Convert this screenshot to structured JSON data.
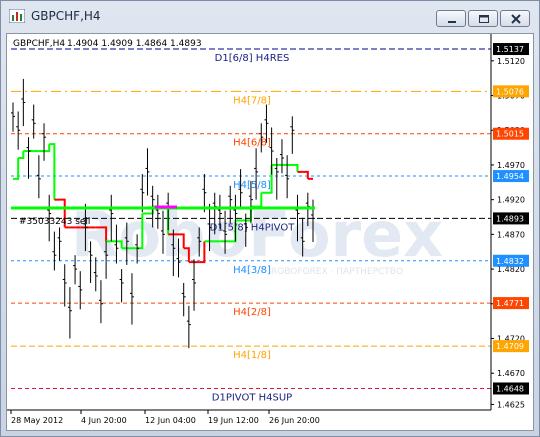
{
  "window": {
    "title": "GBPCHF,H4",
    "buttons": [
      "minimize",
      "restore",
      "close"
    ]
  },
  "chart_header": {
    "symbol": "GBPCHF,H4",
    "ohlc": "1.4904 1.4909 1.4864 1.4893"
  },
  "watermark": "RoboForex",
  "watermark_sub": "ROBOFOREX · ПАРТНЕРСТВО",
  "trade_label": "#35033243 sell",
  "price_axis": {
    "ticks": [
      "1.5120",
      "1.5070",
      "1.5020",
      "1.4970",
      "1.4920",
      "1.4870",
      "1.4820",
      "1.4770",
      "1.4720",
      "1.4670",
      "1.4625"
    ],
    "badges": [
      {
        "text": "1.5137",
        "bg": "#000000",
        "fg": "#ffffff"
      },
      {
        "text": "1.5076",
        "bg": "#ffa500",
        "fg": "#ffffff"
      },
      {
        "text": "1.5015",
        "bg": "#ff4500",
        "fg": "#ffffff"
      },
      {
        "text": "1.4954",
        "bg": "#1e90ff",
        "fg": "#ffffff"
      },
      {
        "text": "1.4893",
        "bg": "#000000",
        "fg": "#ffffff"
      },
      {
        "text": "1.4832",
        "bg": "#1e90ff",
        "fg": "#ffffff"
      },
      {
        "text": "1.4771",
        "bg": "#ff4500",
        "fg": "#ffffff"
      },
      {
        "text": "1.4709",
        "bg": "#ffa500",
        "fg": "#ffffff"
      },
      {
        "text": "1.4648",
        "bg": "#000000",
        "fg": "#ffffff"
      }
    ]
  },
  "time_axis": [
    "28 May 2012",
    "4 Jun 20:00",
    "12 Jun 04:00",
    "19 Jun 12:00",
    "26 Jun 20:00"
  ],
  "levels": [
    {
      "label": "D1[6/8] H4RES",
      "price": 1.5137,
      "color": "#00008b",
      "labelColor": "#1a237e"
    },
    {
      "label": "H4[7/8]",
      "price": 1.5076,
      "color": "#ffa500",
      "labelColor": "#ffa500"
    },
    {
      "label": "H4[6/8]",
      "price": 1.5015,
      "color": "#ff4500",
      "labelColor": "#ff4500"
    },
    {
      "label": "H4[5/8]",
      "price": 1.4954,
      "color": "#1e90ff",
      "labelColor": "#1e90ff"
    },
    {
      "label": "D1[5/8] H4PIVOT",
      "price": 1.4893,
      "color": "#000000",
      "labelColor": "#1a237e"
    },
    {
      "label": "H4[3/8]",
      "price": 1.4832,
      "color": "#1e90ff",
      "labelColor": "#1e90ff"
    },
    {
      "label": "H4[2/8]",
      "price": 1.4771,
      "color": "#ff4500",
      "labelColor": "#ff4500"
    },
    {
      "label": "H4[1/8]",
      "price": 1.4709,
      "color": "#ffa500",
      "labelColor": "#ffa500"
    },
    {
      "label": "D1PIVOT H4SUP",
      "price": 1.4648,
      "color": "#dc143c",
      "labelColor": "#1a237e"
    }
  ],
  "colors": {
    "price_line": "#000000",
    "trail_up": "#00ff00",
    "trail_down": "#ff0000",
    "trade_line": "#00ff00",
    "magenta_marker": "#ff00ff"
  },
  "price_series": [
    1.504,
    1.502,
    1.506,
    1.499,
    1.503,
    1.495,
    1.501,
    1.49,
    1.484,
    1.486,
    1.48,
    1.476,
    1.482,
    1.479,
    1.488,
    1.484,
    1.481,
    1.477,
    1.484,
    1.49,
    1.485,
    1.48,
    1.486,
    1.478,
    1.485,
    1.493,
    1.496,
    1.492,
    1.49,
    1.487,
    1.491,
    1.485,
    1.483,
    1.478,
    1.474,
    1.48,
    1.486,
    1.493,
    1.488,
    1.491,
    1.49,
    1.487,
    1.492,
    1.49,
    1.493,
    1.488,
    1.492,
    1.496,
    1.501,
    1.503,
    1.499,
    1.496,
    1.498,
    1.495,
    1.502,
    1.49,
    1.486,
    1.491,
    1.4893
  ],
  "trail_series": [
    1.495,
    1.498,
    1.499,
    1.499,
    1.499,
    1.499,
    1.499,
    1.5,
    1.492,
    1.492,
    1.488,
    1.488,
    1.488,
    1.488,
    1.488,
    1.488,
    1.488,
    1.488,
    1.486,
    1.486,
    1.486,
    1.485,
    1.485,
    1.485,
    1.485,
    1.49,
    1.49,
    1.491,
    1.491,
    1.491,
    1.487,
    1.487,
    1.487,
    1.485,
    1.483,
    1.483,
    1.483,
    1.486,
    1.486,
    1.486,
    1.486,
    1.486,
    1.486,
    1.489,
    1.489,
    1.489,
    1.491,
    1.491,
    1.493,
    1.493,
    1.497,
    1.497,
    1.497,
    1.497,
    1.497,
    1.496,
    1.496,
    1.495,
    1.495
  ],
  "trail_dir": [
    1,
    1,
    1,
    1,
    1,
    1,
    1,
    1,
    -1,
    -1,
    -1,
    -1,
    -1,
    -1,
    -1,
    -1,
    -1,
    -1,
    1,
    1,
    1,
    1,
    1,
    1,
    1,
    1,
    1,
    1,
    1,
    1,
    -1,
    -1,
    -1,
    -1,
    -1,
    -1,
    -1,
    1,
    1,
    1,
    1,
    1,
    1,
    1,
    1,
    1,
    1,
    1,
    1,
    1,
    1,
    1,
    1,
    1,
    1,
    -1,
    -1,
    -1,
    -1
  ],
  "trade_price": 1.4908
}
